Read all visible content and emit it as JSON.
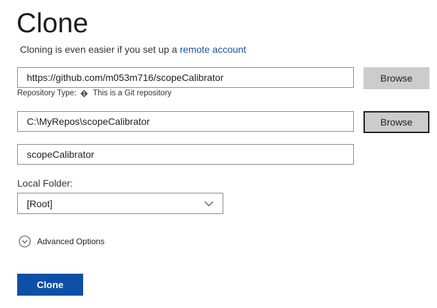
{
  "header": {
    "title": "Clone",
    "subtitle_prefix": "Cloning is even easier if you set up a ",
    "subtitle_link": "remote account"
  },
  "repository": {
    "url_value": "https://github.com/m053m716/scopeCalibrator",
    "browse_label": "Browse",
    "type_label": "Repository Type:",
    "type_value": "This is a Git repository",
    "type_icon": "git-icon"
  },
  "local_path": {
    "value": "C:\\MyRepos\\scopeCalibrator",
    "browse_label": "Browse"
  },
  "repo_name": {
    "value": "scopeCalibrator"
  },
  "local_folder": {
    "label": "Local Folder:",
    "selected": "[Root]",
    "icon": "chevron-down-icon"
  },
  "advanced": {
    "label": "Advanced Options",
    "icon": "chevron-down-circle-icon"
  },
  "actions": {
    "clone_label": "Clone"
  },
  "colors": {
    "primary": "#0e4fa8",
    "link": "#1a52a3",
    "button_gray": "#cccccc"
  }
}
